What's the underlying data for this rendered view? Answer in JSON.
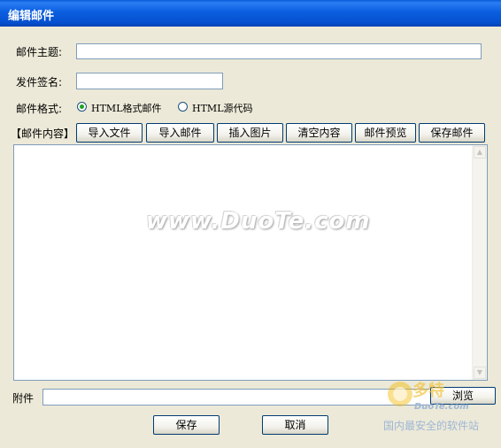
{
  "window": {
    "title": "编辑邮件"
  },
  "form": {
    "subject_label": "邮件主题:",
    "subject_value": "",
    "signature_label": "发件签名:",
    "signature_value": "",
    "format_label": "邮件格式:",
    "format_options": [
      {
        "label": "HTML格式邮件",
        "selected": true
      },
      {
        "label": "HTML源代码",
        "selected": false
      }
    ],
    "content_label": "【邮件内容】",
    "content_value": "",
    "attachment_label": "附件",
    "attachment_value": ""
  },
  "toolbar": {
    "buttons": [
      "导入文件",
      "导入邮件",
      "插入图片",
      "清空内容",
      "邮件预览",
      "保存邮件"
    ]
  },
  "browse_label": "浏览",
  "footer": {
    "save_label": "保存",
    "cancel_label": "取消"
  },
  "watermark": {
    "text": "www.DuoTe.com"
  },
  "brand": {
    "name": "多特",
    "site": "DuoTe.com",
    "tagline": "国内最安全的软件站",
    "accent_color": "#f2b705",
    "text_color": "#9fb7d5"
  },
  "colors": {
    "titlebar": "#0650d0",
    "dialog_bg": "#ece9d8",
    "input_border": "#7f9db9"
  }
}
